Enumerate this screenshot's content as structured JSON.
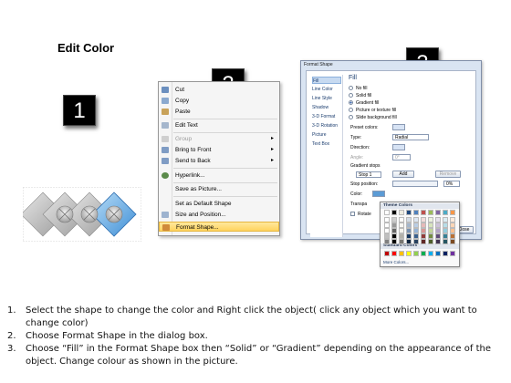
{
  "title": "Edit Color",
  "steps": [
    "1",
    "2",
    "3"
  ],
  "context_menu": {
    "items": [
      {
        "label": "Cut",
        "icon": "scissors-icon",
        "disabled": false,
        "submenu": false
      },
      {
        "label": "Copy",
        "icon": "copy-icon",
        "disabled": false,
        "submenu": false
      },
      {
        "label": "Paste",
        "icon": "paste-icon",
        "disabled": false,
        "submenu": false
      },
      {
        "label": "Edit Text",
        "icon": "edit-text-icon",
        "disabled": false,
        "submenu": false
      },
      {
        "label": "Group",
        "icon": "group-icon",
        "disabled": true,
        "submenu": true
      },
      {
        "label": "Bring to Front",
        "icon": "bring-front-icon",
        "disabled": false,
        "submenu": true
      },
      {
        "label": "Send to Back",
        "icon": "send-back-icon",
        "disabled": false,
        "submenu": true
      },
      {
        "label": "Hyperlink...",
        "icon": "hyperlink-icon",
        "disabled": false,
        "submenu": false
      },
      {
        "label": "Save as Picture...",
        "icon": "",
        "disabled": false,
        "submenu": false
      },
      {
        "label": "Set as Default Shape",
        "icon": "",
        "disabled": false,
        "submenu": false
      },
      {
        "label": "Size and Position...",
        "icon": "size-position-icon",
        "disabled": false,
        "submenu": false
      },
      {
        "label": "Format Shape...",
        "icon": "format-shape-icon",
        "disabled": false,
        "submenu": false
      }
    ],
    "highlighted": "Format Shape..."
  },
  "dialog": {
    "title": "Format Shape",
    "nav": [
      "Fill",
      "Line Color",
      "Line Style",
      "Shadow",
      "3-D Format",
      "3-D Rotation",
      "Picture",
      "Text Box"
    ],
    "selected_nav": "Fill",
    "heading": "Fill",
    "options": [
      "No fill",
      "Solid fill",
      "Gradient fill",
      "Picture or texture fill",
      "Slide background fill"
    ],
    "selected_option": "Gradient fill",
    "preset_colors_label": "Preset colors:",
    "type_label": "Type:",
    "type_value": "Radial",
    "direction_label": "Direction:",
    "angle_label": "Angle:",
    "angle_value": "0°",
    "gradient_stops_label": "Gradient stops",
    "stop_value": "Stop 1",
    "add_label": "Add",
    "remove_label": "Remove",
    "stop_position_label": "Stop position:",
    "stop_position_value": "0%",
    "color_label": "Color:",
    "transparency_label": "Transpa",
    "rotate_label": "Rotate",
    "close_label": "Close"
  },
  "palette": {
    "theme_label": "Theme Colors",
    "standard_label": "Standard Colors",
    "more_label": "More Colors...",
    "top_row": [
      "#ffffff",
      "#000000",
      "#eeece1",
      "#1f497d",
      "#4f81bd",
      "#c0504d",
      "#9bbb59",
      "#8064a2",
      "#4bacc6",
      "#f79646"
    ],
    "standard": [
      "#c00000",
      "#ff0000",
      "#ffc000",
      "#ffff00",
      "#92d050",
      "#00b050",
      "#00b0f0",
      "#0070c0",
      "#002060",
      "#7030a0"
    ]
  },
  "instructions": [
    {
      "num": "1.",
      "text": "Select the shape to change the color and Right click the object( click any object which you want to change color)"
    },
    {
      "num": "2.",
      "text": "Choose Format Shape in the dialog box."
    },
    {
      "num": "3.",
      "text": "Choose “Fill” in the Format Shape box then “Solid” or “Gradient” depending on the appearance of the object. Change colour as shown in the picture."
    }
  ]
}
